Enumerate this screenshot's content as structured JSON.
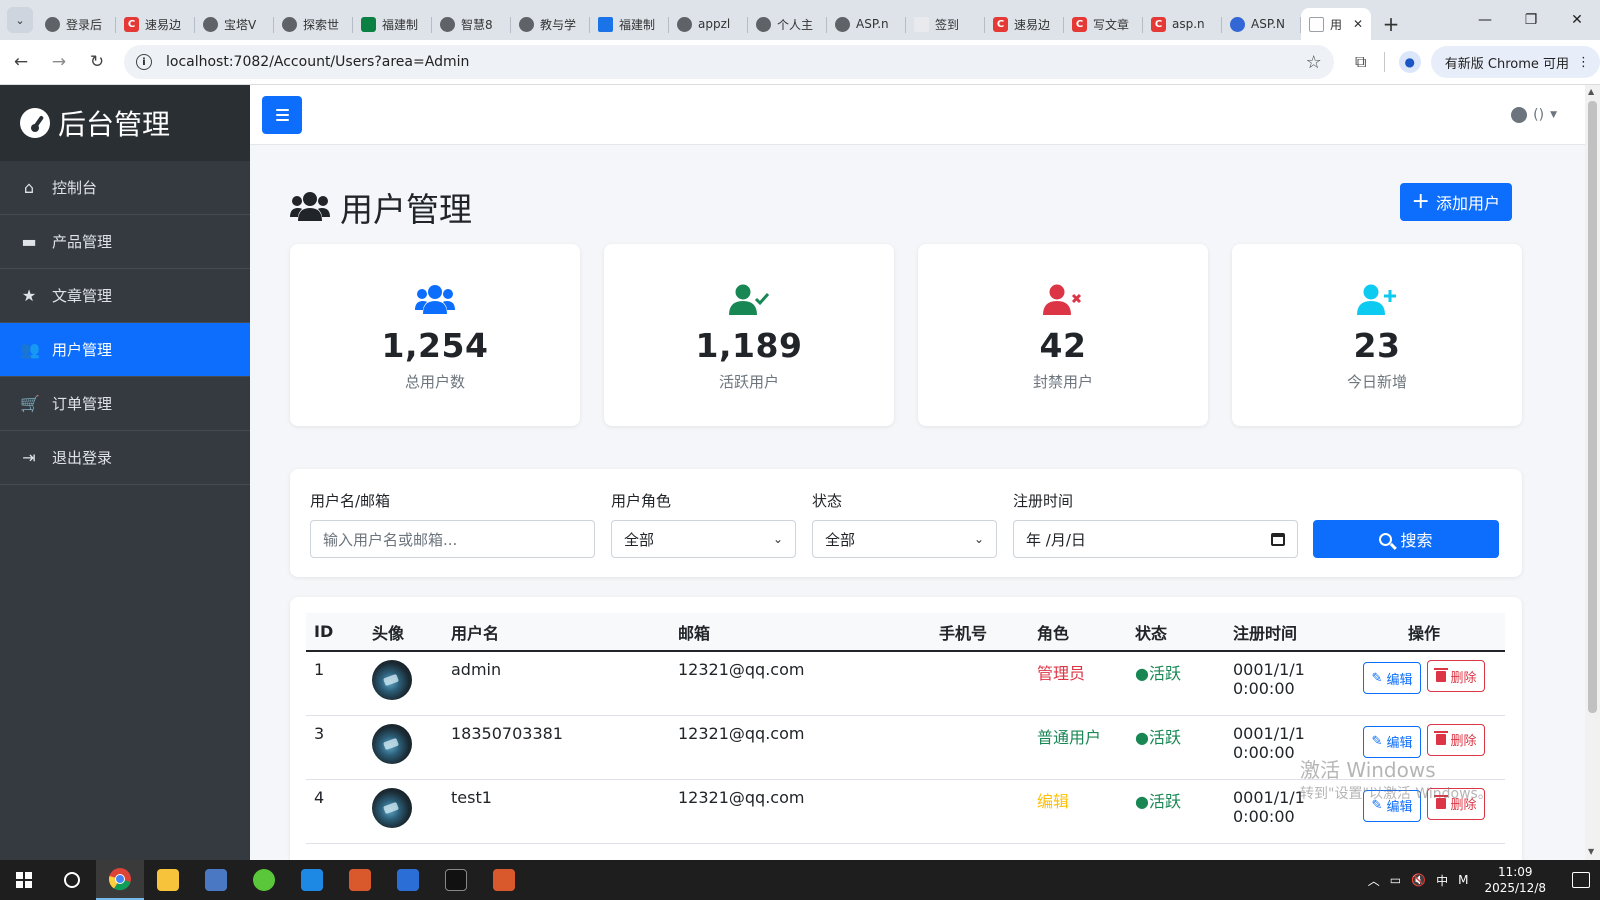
{
  "browser": {
    "tabs": [
      {
        "label": "登录后",
        "icon": "globe"
      },
      {
        "label": "速易边",
        "icon": "red"
      },
      {
        "label": "宝塔V",
        "icon": "globe"
      },
      {
        "label": "探索世",
        "icon": "globe"
      },
      {
        "label": "福建制",
        "icon": "lock"
      },
      {
        "label": "智慧8",
        "icon": "globe"
      },
      {
        "label": "教与学",
        "icon": "globe"
      },
      {
        "label": "福建制",
        "icon": "monitor"
      },
      {
        "label": "appzl",
        "icon": "globe"
      },
      {
        "label": "个人主",
        "icon": "globe"
      },
      {
        "label": "ASP.n",
        "icon": "globe"
      },
      {
        "label": "签到",
        "icon": "blank"
      },
      {
        "label": "速易边",
        "icon": "red"
      },
      {
        "label": "写文章",
        "icon": "red"
      },
      {
        "label": "asp.n",
        "icon": "red"
      },
      {
        "label": "ASP.N",
        "icon": "blue"
      }
    ],
    "active_tab": {
      "label": "用",
      "close": "✕"
    },
    "new_tab": "+",
    "url": "localhost:7082/Account/Users?area=Admin",
    "update_label": "有新版 Chrome 可用"
  },
  "sidebar": {
    "brand": "后台管理",
    "items": [
      {
        "label": "控制台",
        "icon": "home-icon",
        "glyph": "⌂",
        "active": false
      },
      {
        "label": "产品管理",
        "icon": "briefcase-icon",
        "glyph": "▬",
        "active": false
      },
      {
        "label": "文章管理",
        "icon": "star-icon",
        "glyph": "★",
        "active": false
      },
      {
        "label": "用户管理",
        "icon": "users-icon",
        "glyph": "👥",
        "active": true
      },
      {
        "label": "订单管理",
        "icon": "cart-icon",
        "glyph": "🛒",
        "active": false
      },
      {
        "label": "退出登录",
        "icon": "sign-out-icon",
        "glyph": "⇥",
        "active": false
      }
    ]
  },
  "topnav": {
    "user_count": "()"
  },
  "page": {
    "title": "用户管理",
    "add_button": "添加用户"
  },
  "stats": [
    {
      "value": "1,254",
      "label": "总用户数",
      "icon": "users-icon",
      "color": "#0d6efd"
    },
    {
      "value": "1,189",
      "label": "活跃用户",
      "icon": "user-check-icon",
      "color": "#198754"
    },
    {
      "value": "42",
      "label": "封禁用户",
      "icon": "user-times-icon",
      "color": "#dc3545"
    },
    {
      "value": "23",
      "label": "今日新增",
      "icon": "user-plus-icon",
      "color": "#0dcaf0"
    }
  ],
  "filters": {
    "username_label": "用户名/邮箱",
    "username_placeholder": "输入用户名或邮箱...",
    "role_label": "用户角色",
    "role_value": "全部",
    "status_label": "状态",
    "status_value": "全部",
    "date_label": "注册时间",
    "date_value": "年 /月/日",
    "search_button": "搜索"
  },
  "table": {
    "headers": [
      "ID",
      "头像",
      "用户名",
      "邮箱",
      "手机号",
      "角色",
      "状态",
      "注册时间",
      "操作"
    ],
    "rows": [
      {
        "id": "1",
        "username": "admin",
        "email": "12321@qq.com",
        "phone": "",
        "role": "管理员",
        "role_class": "role-admin",
        "status": "●活跃",
        "date": "0001/1/1",
        "time": "0:00:00"
      },
      {
        "id": "3",
        "username": "18350703381",
        "email": "12321@qq.com",
        "phone": "",
        "role": "普通用户",
        "role_class": "role-user",
        "status": "●活跃",
        "date": "0001/1/1",
        "time": "0:00:00"
      },
      {
        "id": "4",
        "username": "test1",
        "email": "12321@qq.com",
        "phone": "",
        "role": "编辑",
        "role_class": "role-editor",
        "status": "●活跃",
        "date": "0001/1/1",
        "time": "0:00:00"
      }
    ],
    "edit_label": "编辑",
    "delete_label": "删除"
  },
  "watermark": {
    "line1": "激活 Windows",
    "line2": "转到\"设置\"以激活 Windows。"
  },
  "taskbar": {
    "time": "11:09",
    "date": "2025/12/8",
    "ime": "中"
  }
}
